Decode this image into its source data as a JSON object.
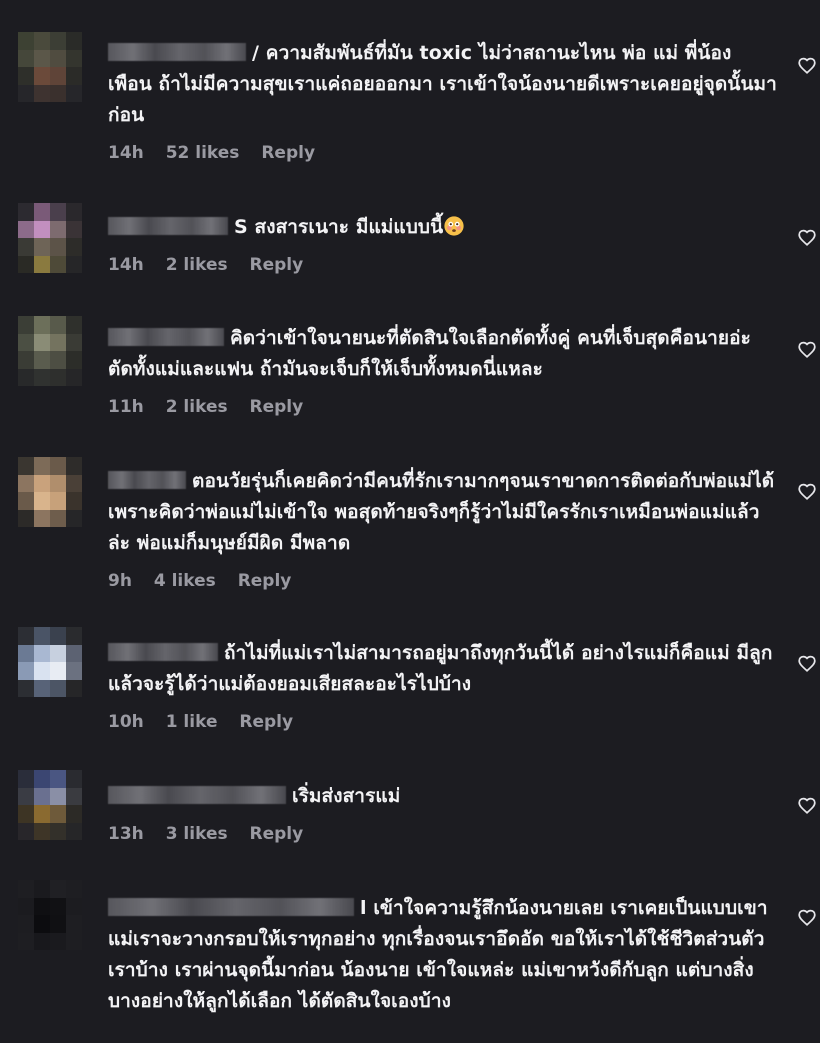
{
  "comments": [
    {
      "text": "/ ความสัมพันธ์ที่มัน toxic ไม่ว่าสถานะไหน พ่อ แม่ พี่น้อง เพือน ถ้าไม่มีความสุขเราแค่ถอยออกมา เราเข้าใจน้องนายดีเพราะเคยอยู่จุดนั้นมาก่อน",
      "time": "14h",
      "likes": "52 likes",
      "reply": "Reply"
    },
    {
      "text": "S สงสารเนาะ มีแม่แบบนี้",
      "emoji": "flushed-face-emoji",
      "time": "14h",
      "likes": "2 likes",
      "reply": "Reply"
    },
    {
      "text": "คิดว่าเข้าใจนายนะที่ตัดสินใจเลือกตัดทั้งคู่ คนที่เจ็บสุดคือนายอ่ะ ตัดทั้งแม่และแฟน ถ้ามันจะเจ็บก็ให้เจ็บทั้งหมดนี่แหละ",
      "time": "11h",
      "likes": "2 likes",
      "reply": "Reply"
    },
    {
      "text": "ตอนวัยรุ่นก็เคยคิดว่ามีคนที่รักเรามากๆจนเราขาดการติดต่อกับพ่อแม่ได้ เพราะคิดว่าพ่อแม่ไม่เข้าใจ พอสุดท้ายจริงๆก็รู้ว่าไม่มีใครรักเราเหมือนพ่อแม่แล้วล่ะ พ่อแม่ก็มนุษย์มีผิด มีพลาด",
      "time": "9h",
      "likes": "4 likes",
      "reply": "Reply"
    },
    {
      "text": "ถ้าไม่ที่แม่เราไม่สามารถอยู่มาถึงทุกวันนี้ได้ อย่างไรแม่ก็คือแม่ มีลูกแล้วจะรู้ได้ว่าแม่ต้องยอมเสียสละอะไรไปบ้าง",
      "time": "10h",
      "likes": "1 like",
      "reply": "Reply"
    },
    {
      "text": "เริ่มส่งสารแม่",
      "time": "13h",
      "likes": "3 likes",
      "reply": "Reply"
    },
    {
      "text": "l เข้าใจความรู้สึกน้องนายเลย เราเคยเป็นแบบเขา แม่เราจะวางกรอบให้เราทุกอย่าง ทุกเรื่องจนเราอึดอัด ขอให้เราได้ใช้ชีวิตส่วนตัวเราบ้าง เราผ่านจุดนี้มาก่อน น้องนาย เข้าใจแหล่ะ แม่เขาหวังดีกับลูก แต่บางสิ่งบางอย่างให้ลูกได้เลือก ได้ตัดสินใจเองบ้าง"
    }
  ],
  "icons": {
    "like": "heart-outline-icon"
  },
  "colors": {
    "background": "#1c1c21",
    "text": "#f3f3f5",
    "meta": "#9a9aa2"
  }
}
